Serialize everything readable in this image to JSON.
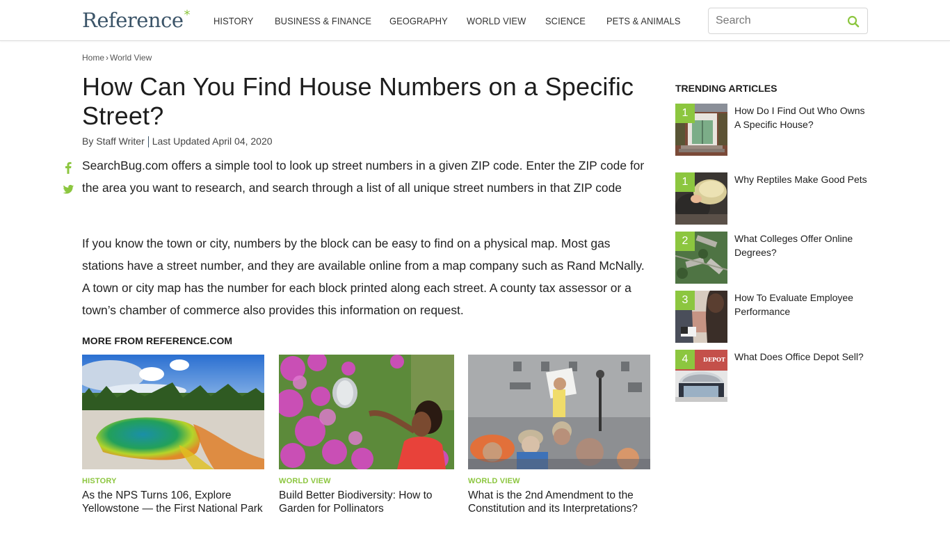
{
  "header": {
    "logo_text": "Reference",
    "logo_mark": "*",
    "nav": [
      "HISTORY",
      "BUSINESS & FINANCE",
      "GEOGRAPHY",
      "WORLD VIEW",
      "SCIENCE",
      "PETS & ANIMALS"
    ],
    "search_placeholder": "Search",
    "search_icon": "search-icon"
  },
  "breadcrumb": {
    "home": "Home",
    "separator": "›",
    "current": "World View"
  },
  "article": {
    "title": "How Can You Find House Numbers on a Specific Street?",
    "author": "By Staff Writer",
    "updated": "Last Updated April 04, 2020",
    "paragraphs": [
      "SearchBug.com offers a simple tool to look up street numbers in a given ZIP code. Enter the ZIP code for the area you want to research, and search through a list of all unique street numbers in that ZIP code",
      "If you know the town or city, numbers by the block can be easy to find on a physical map. Most gas stations have a street number, and they are available online from a map company such as Rand McNally. A town or city map has the number for each block printed along each street. A county tax assessor or a town’s chamber of commerce also provides this information on request."
    ],
    "social": [
      "facebook-icon",
      "twitter-icon"
    ]
  },
  "more": {
    "heading": "MORE FROM REFERENCE.COM",
    "cards": [
      {
        "category": "HISTORY",
        "title": "As the NPS Turns 106, Explore Yellowstone — the First National Park",
        "image": "yellowstone-hot-spring"
      },
      {
        "category": "WORLD VIEW",
        "title": "Build Better Biodiversity: How to Garden for Pollinators",
        "image": "girl-watering-flowers"
      },
      {
        "category": "WORLD VIEW",
        "title": "What is the 2nd Amendment to the Constitution and its Interpretations?",
        "image": "rally-crowd"
      }
    ]
  },
  "trending": {
    "heading": "TRENDING ARTICLES",
    "items": [
      {
        "rank": "1",
        "title": "How Do I Find Out Who Owns A Specific House?",
        "image": "house-door"
      },
      {
        "rank": "1",
        "title": "Why Reptiles Make Good Pets",
        "image": "turtle"
      },
      {
        "rank": "2",
        "title": "What Colleges Offer Online Degrees?",
        "image": "campus-aerial"
      },
      {
        "rank": "3",
        "title": "How To Evaluate Employee Performance",
        "image": "office-meeting"
      },
      {
        "rank": "4",
        "title": "What Does Office Depot Sell?",
        "image": "office-depot-store"
      }
    ]
  },
  "colors": {
    "accent": "#8cc63f",
    "logo": "#3b5468",
    "text": "#1d1d1d"
  }
}
